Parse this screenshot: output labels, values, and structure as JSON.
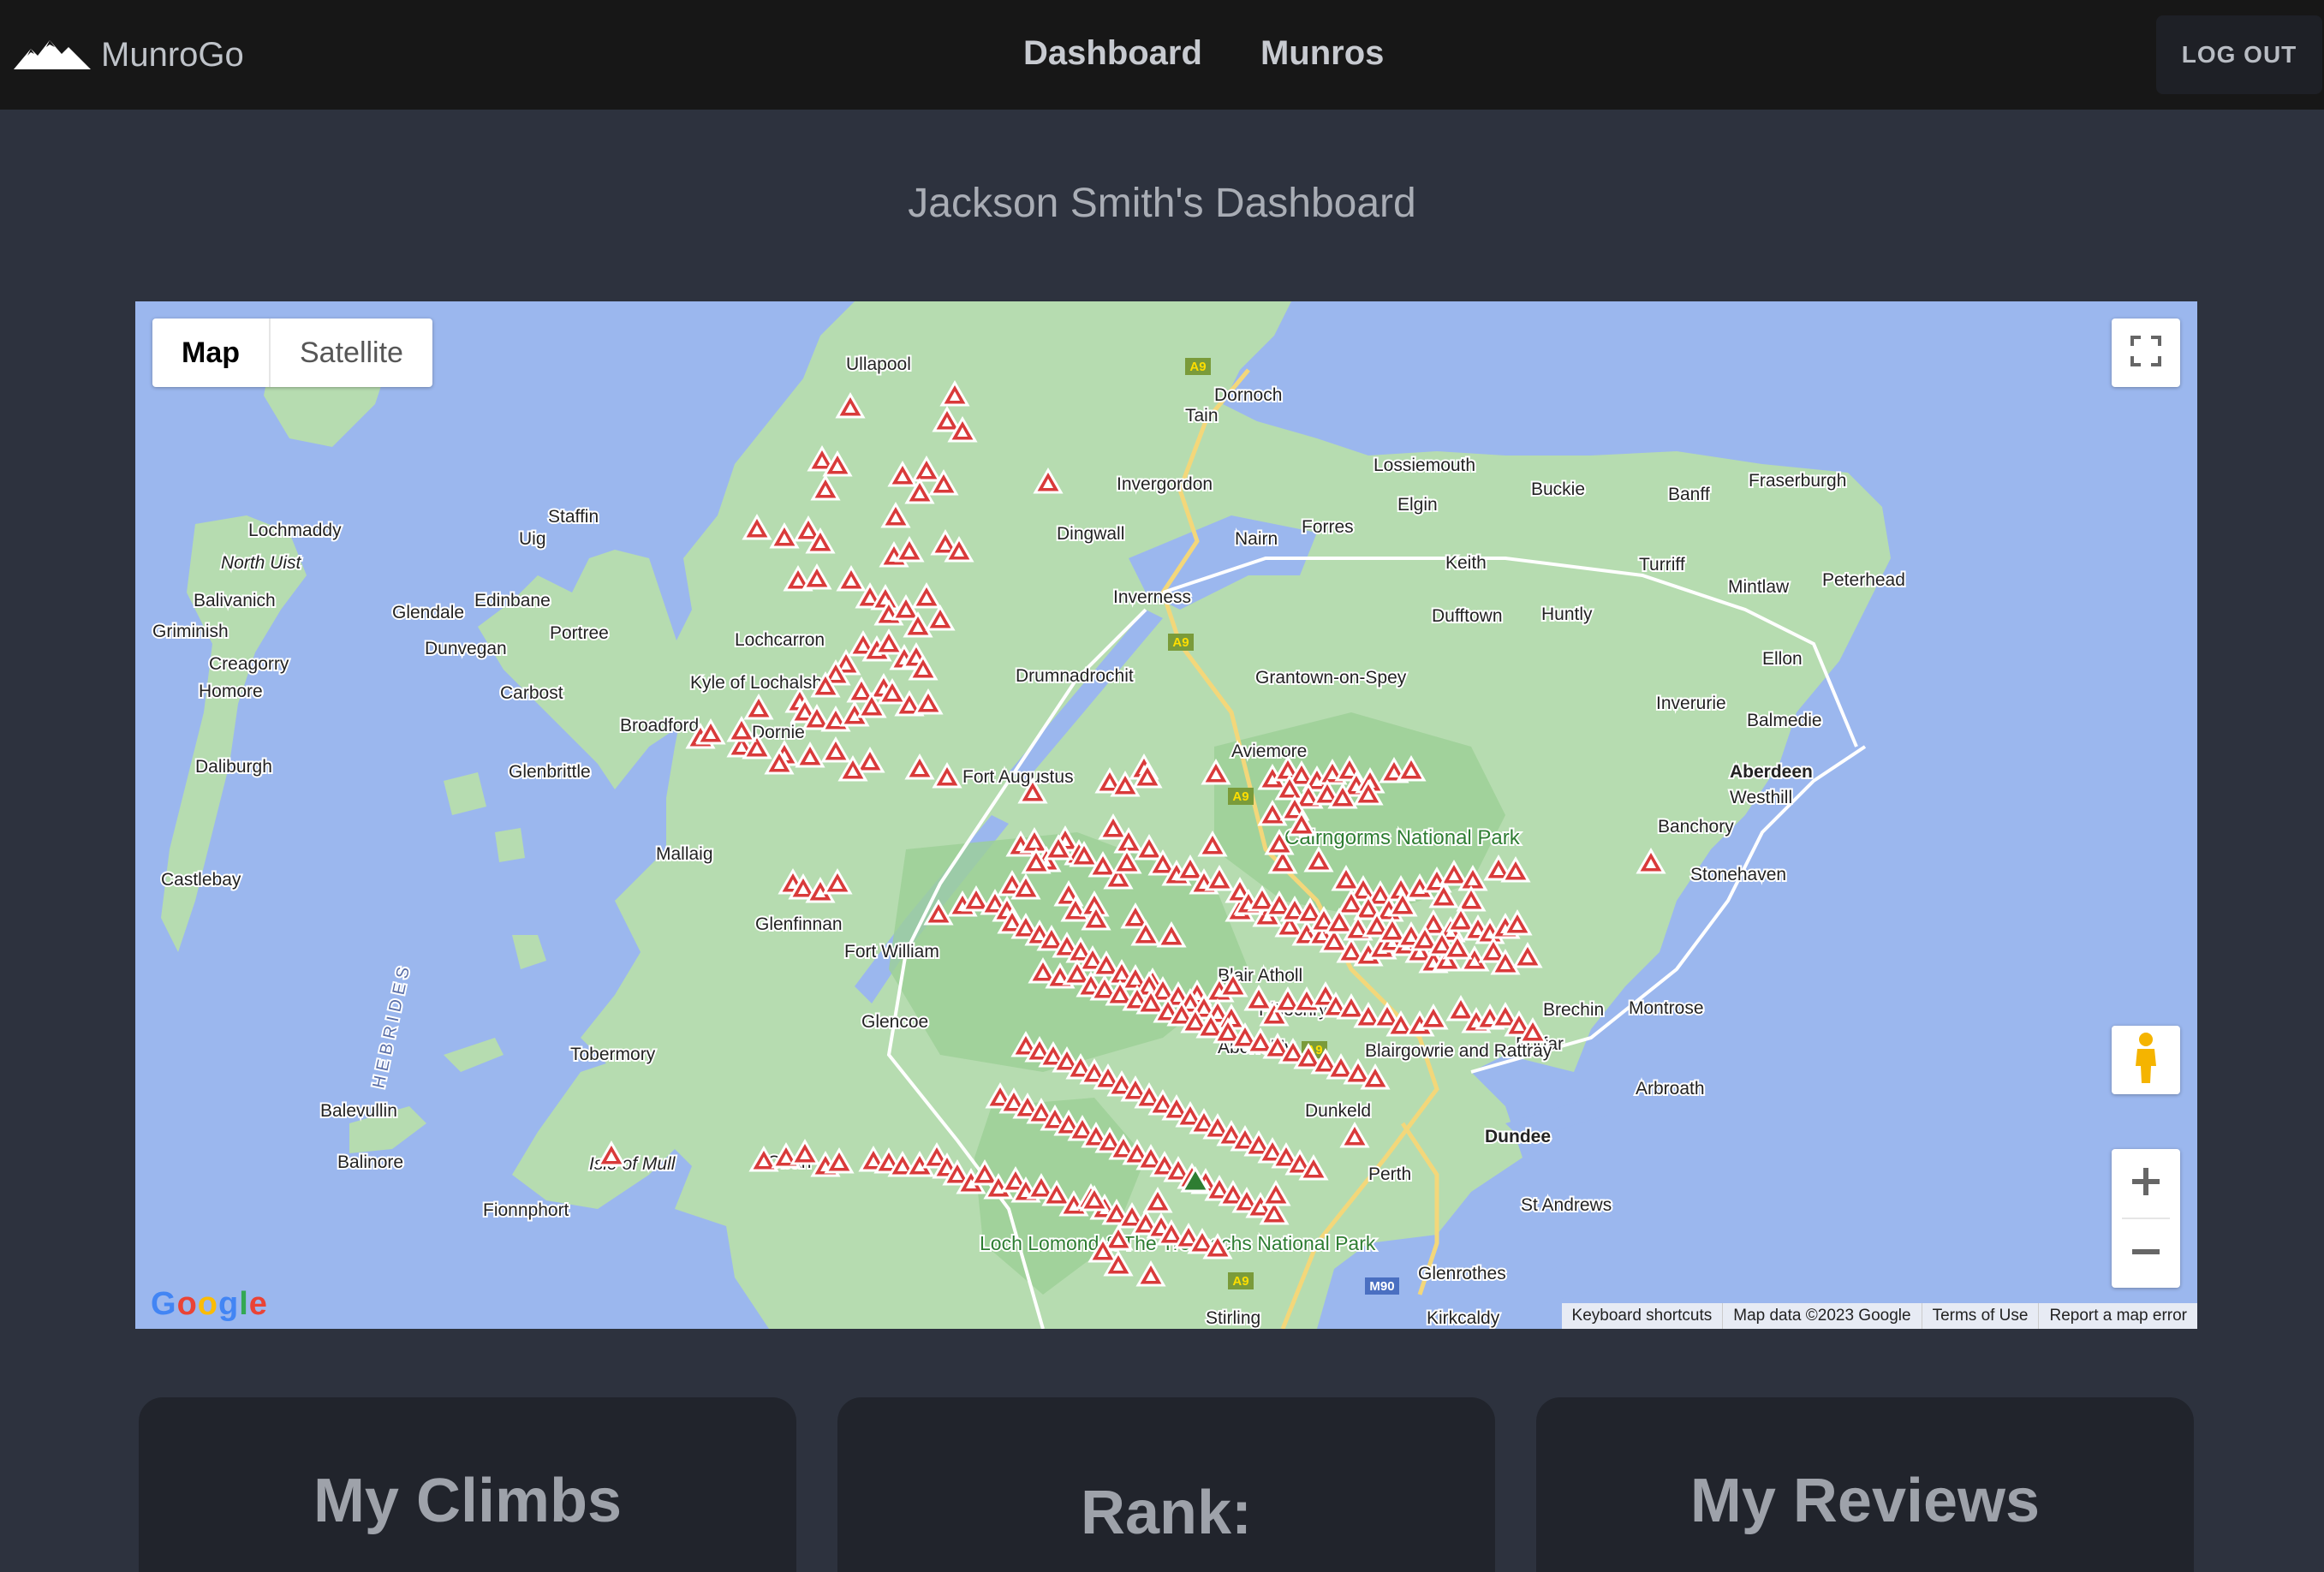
{
  "navbar": {
    "brand": "MunroGo",
    "links": [
      "Dashboard",
      "Munros"
    ],
    "logout_label": "LOG OUT"
  },
  "page": {
    "title": "Jackson Smith's Dashboard"
  },
  "map": {
    "type_controls": {
      "map": "Map",
      "satellite": "Satellite"
    },
    "places": [
      "Ullapool",
      "Dornoch",
      "Tain",
      "Invergordon",
      "Lossiemouth",
      "Buckie",
      "Banff",
      "Fraserburgh",
      "Elgin",
      "Dingwall",
      "Nairn",
      "Forres",
      "Lochmaddy",
      "North Uist",
      "Staffin",
      "Uig",
      "Balivanich",
      "Griminish",
      "Glendale",
      "Edinbane",
      "Portree",
      "Dunvegan",
      "Creagorry",
      "Homore",
      "Carbost",
      "Broadford",
      "Glenbrittle",
      "Lochcarron",
      "Kyle of Lochalsh",
      "Dornie",
      "Inverness",
      "Drumnadrochit",
      "Grantown-on-Spey",
      "Keith",
      "Turriff",
      "Mintlaw",
      "Peterhead",
      "Dufftown",
      "Huntly",
      "Ellon",
      "Inverurie",
      "Balmedie",
      "Aberdeen",
      "Westhill",
      "Banchory",
      "Stonehaven",
      "Aviemore",
      "Fort Augustus",
      "Cairngorms National Park",
      "Daliburgh",
      "Mallaig",
      "Castlebay",
      "Glenfinnan",
      "Fort William",
      "Blair Atholl",
      "Pitlochry",
      "Brechin",
      "Montrose",
      "Forfar",
      "Arbroath",
      "Aberfeldy",
      "Blairgowrie and Rattray",
      "Dunkeld",
      "Dundee",
      "Tobermory",
      "Balevullin",
      "Balinore",
      "Isle of Mull",
      "Oban",
      "Fionnphort",
      "Perth",
      "St Andrews",
      "Glenrothes",
      "Kirkcaldy",
      "Stirling",
      "Loch Lomond & The Trossachs National Park",
      "HEBRIDES",
      "Glencoe"
    ],
    "road_shields": [
      "A9",
      "A9",
      "A9",
      "A9",
      "A9",
      "M90"
    ],
    "attribution": [
      "Keyboard shortcuts",
      "Map data ©2023 Google",
      "Terms of Use",
      "Report a map error"
    ],
    "logo": "Google",
    "marker_color": "#d93a3a",
    "climbed_marker_color": "#2e7d32"
  },
  "cards": {
    "climbs_title": "My Climbs",
    "rank_title": "Rank:",
    "reviews_title": "My Reviews"
  },
  "colors": {
    "background": "#2d323e",
    "navbar": "#171717",
    "card": "#21242c",
    "water": "#9bb7ee",
    "land": "#b6dcb0"
  }
}
